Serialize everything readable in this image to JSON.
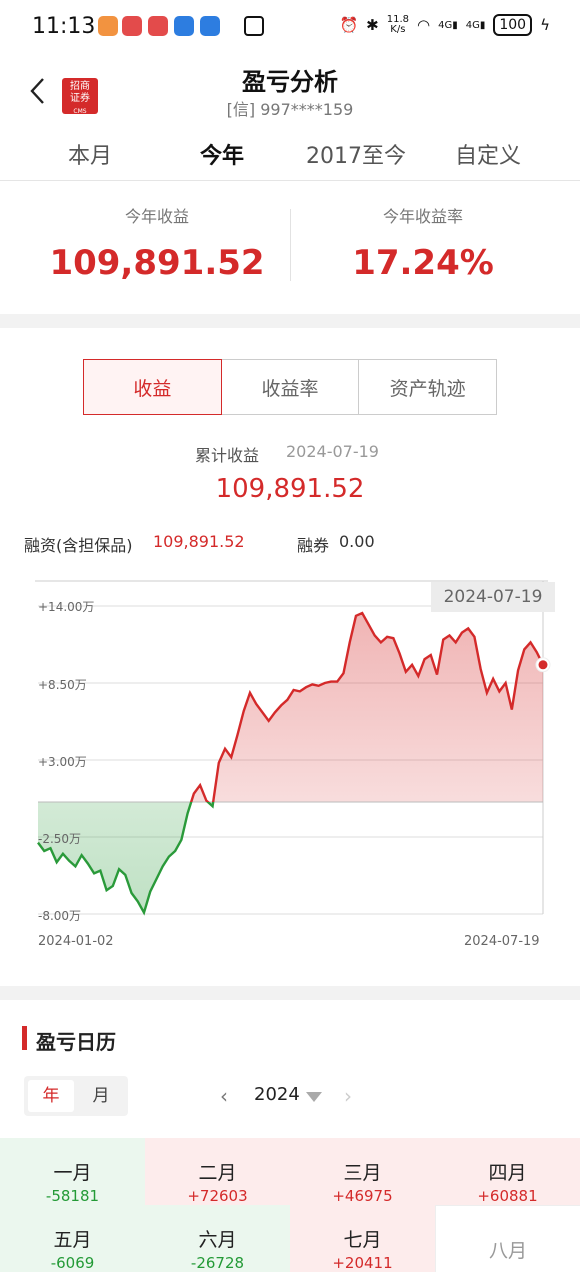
{
  "status_bar": {
    "time": "11:13",
    "net_speed_value": "11.8",
    "net_speed_unit": "K/s",
    "signal_1": "4G",
    "signal_2": "4G",
    "battery": "100"
  },
  "header": {
    "logo_line1": "招商",
    "logo_line2": "证券",
    "logo_line3": "CMS",
    "title": "盈亏分析",
    "account": "[信] 997****159"
  },
  "period_tabs": [
    "本月",
    "今年",
    "2017至今",
    "自定义"
  ],
  "summary": {
    "profit_label": "今年收益",
    "profit_value": "109,891.52",
    "rate_label": "今年收益率",
    "rate_value": "17.24%"
  },
  "metric_tabs": [
    "收益",
    "收益率",
    "资产轨迹"
  ],
  "cumulative": {
    "label": "累计收益",
    "date": "2024-07-19",
    "value": "109,891.52"
  },
  "financing": {
    "label": "融资(含担保品)",
    "value": "109,891.52",
    "securities_label": "融券",
    "securities_value": "0.00"
  },
  "chart_data": {
    "type": "area",
    "tooltip_date": "2024-07-19",
    "y_tick_labels": [
      "+14.00万",
      "+8.50万",
      "+3.00万",
      "-2.50万",
      "-8.00万"
    ],
    "y_ticks": [
      14.0,
      8.5,
      3.0,
      -2.5,
      -8.0
    ],
    "ylim": [
      -8.0,
      14.0
    ],
    "x_labels": [
      "2024-01-02",
      "2024-07-19"
    ],
    "y_unit": "万",
    "positive_color": "#d42a2a",
    "negative_color": "#2a9a3a",
    "series": [
      {
        "values": [
          -2.9,
          -3.5,
          -3.3,
          -4.3,
          -3.7,
          -4.2,
          -4.6,
          -3.8,
          -4.4,
          -5.1,
          -4.9,
          -6.3,
          -6.0,
          -4.8,
          -5.2,
          -6.5,
          -7.1,
          -7.9,
          -6.4,
          -5.5,
          -4.6,
          -3.9,
          -3.5,
          -2.7,
          -0.8,
          0.6,
          1.2,
          0.1,
          -0.3,
          2.8,
          3.8,
          3.2,
          4.8,
          6.5,
          7.8,
          7.0,
          6.4,
          5.8,
          6.4,
          6.9,
          7.3,
          8.0,
          7.9,
          8.2,
          8.4,
          8.3,
          8.5,
          8.6,
          8.6,
          9.2,
          11.4,
          13.3,
          13.5,
          12.7,
          11.9,
          11.4,
          11.8,
          11.7,
          10.6,
          9.3,
          9.8,
          9.0,
          10.2,
          10.5,
          9.1,
          11.6,
          11.9,
          11.4,
          12.1,
          12.4,
          11.8,
          9.5,
          7.8,
          8.8,
          7.9,
          8.5,
          6.6,
          9.4,
          10.9,
          11.4,
          10.7,
          9.8
        ]
      }
    ]
  },
  "calendar": {
    "title": "盈亏日历",
    "toggle_year": "年",
    "toggle_month": "月",
    "prev_icon": "‹",
    "next_icon": "›",
    "year": "2024",
    "months": [
      {
        "label": "一月",
        "value": "-58181",
        "tone": "loss"
      },
      {
        "label": "二月",
        "value": "+72603",
        "tone": "gain"
      },
      {
        "label": "三月",
        "value": "+46975",
        "tone": "gain"
      },
      {
        "label": "四月",
        "value": "+60881",
        "tone": "gain"
      },
      {
        "label": "五月",
        "value": "-6069",
        "tone": "loss"
      },
      {
        "label": "六月",
        "value": "-26728",
        "tone": "loss"
      },
      {
        "label": "七月",
        "value": "+20411",
        "tone": "gain"
      },
      {
        "label": "八月",
        "value": "",
        "tone": "empty"
      }
    ]
  }
}
